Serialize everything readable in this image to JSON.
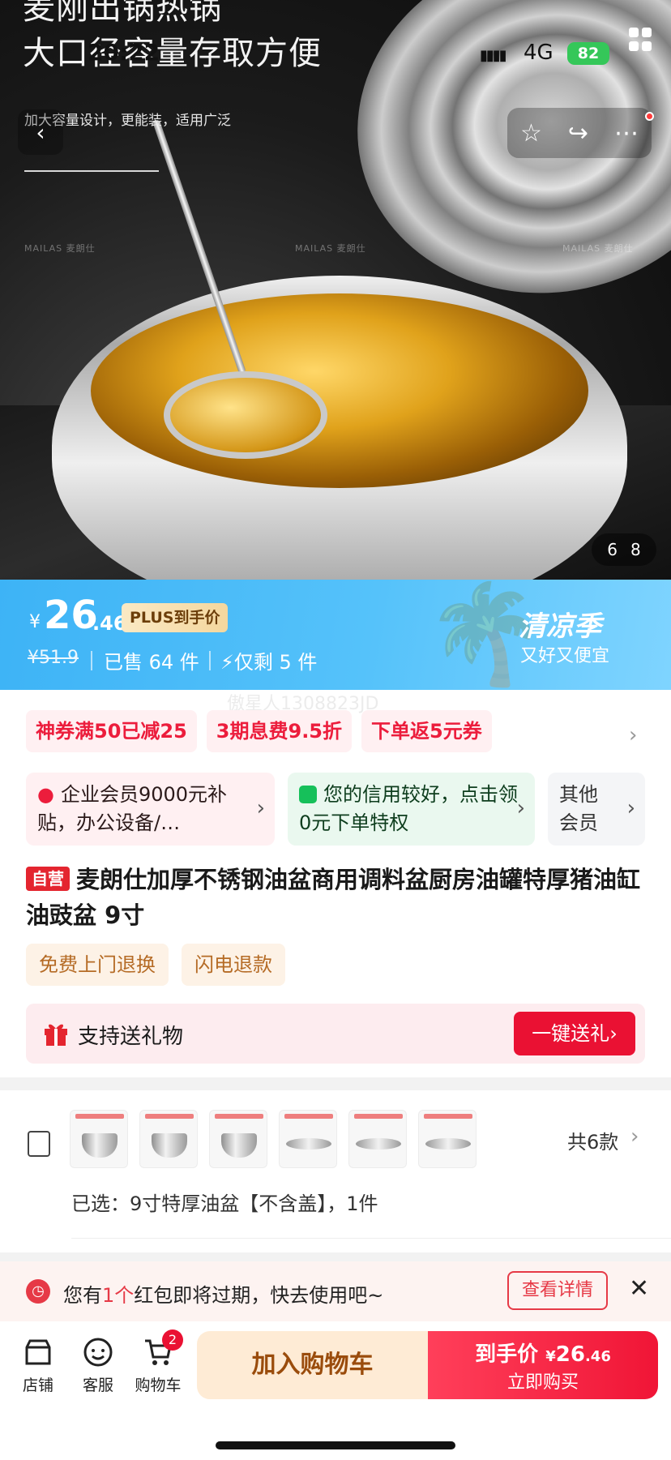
{
  "status": {
    "time": "20:22",
    "network": "4G",
    "battery": "82"
  },
  "hero": {
    "headline_1": "麦刚出锅热锅",
    "headline_2": "大口径容量存取方便",
    "subline": "加大容量设计，更能装，适用广泛",
    "brand_marks": [
      "MAILAS 麦朗仕",
      "MAILAS 麦朗仕",
      "MAILAS 麦朗仕"
    ],
    "pager": {
      "current": "6",
      "total": "8"
    }
  },
  "price": {
    "currency": "¥",
    "integer": "26",
    "decimal": ".46",
    "plus_label": "PLUS到手价",
    "original": "¥51.9",
    "sold": "已售 64 件",
    "remaining": "仅剩 5 件",
    "season_title": "清凉季",
    "season_slogan": "又好又便宜"
  },
  "watermark": "傲星人1308823JD",
  "coupons": [
    "神券满50已减25",
    "3期息费9.5折",
    "下单返5元券"
  ],
  "member_cards": {
    "biz": "企业会员9000元补贴，办公设备/…",
    "credit": "您的信用较好，点击领0元下单特权",
    "other": "其他会员"
  },
  "product": {
    "badge": "自营",
    "title": "麦朗仕加厚不锈钢油盆商用调料盆厨房油罐特厚猪油缸油豉盆 9寸"
  },
  "service_tags": [
    "免费上门退换",
    "闪电退款"
  ],
  "gift": {
    "label": "支持送礼物",
    "button": "一键送礼"
  },
  "variants": {
    "count_label": "共6款",
    "selected": "已选：9寸特厚油盆【不含盖】，1件"
  },
  "notice": {
    "prefix": "您有",
    "highlight": "1个",
    "suffix": "红包即将过期，快去使用吧~",
    "button": "查看详情"
  },
  "bottom": {
    "store": "店铺",
    "service": "客服",
    "cart": "购物车",
    "cart_badge": "2",
    "add_to_cart": "加入购物车",
    "buy_prefix": "到手价",
    "buy_currency": "¥",
    "buy_integer": "26",
    "buy_decimal": ".46",
    "buy_now": "立即购买"
  },
  "colors": {
    "accent_red": "#ea1133",
    "price_bar_blue": "#3db3f6",
    "cart_orange": "#feebd5"
  }
}
